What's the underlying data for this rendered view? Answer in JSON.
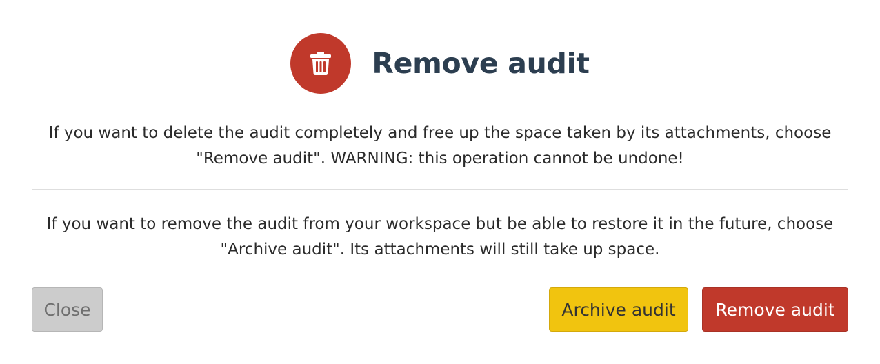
{
  "dialog": {
    "title": "Remove audit",
    "icon": "trash-icon",
    "message_remove": "If you want to delete the audit completely and free up the space taken by its attachments, choose \"Remove audit\". WARNING: this operation cannot be undone!",
    "message_archive": "If you want to remove the audit from your workspace but be able to restore it in the future, choose \"Archive audit\". Its attachments will still take up space."
  },
  "buttons": {
    "close_label": "Close",
    "archive_label": "Archive audit",
    "remove_label": "Remove audit"
  },
  "colors": {
    "danger": "#c0392b",
    "warning": "#f1c40f",
    "title": "#2c3e50",
    "neutral": "#cccccc"
  }
}
